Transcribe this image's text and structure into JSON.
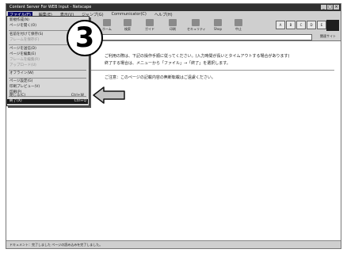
{
  "window": {
    "title": "Content Server For WEB Input - Netscape",
    "buttons": [
      "_",
      "□",
      "×"
    ]
  },
  "menubar": [
    "ファイル(F)",
    "編集(E)",
    "表示(V)",
    "ジャンプ(G)",
    "Communicator(C)",
    "ヘルプ(H)"
  ],
  "toolbar": {
    "buttons": [
      "戻る",
      "進む",
      "再読込み",
      "ホーム",
      "検索",
      "ガイド",
      "印刷",
      "セキュリティ",
      "Shop",
      "中止"
    ],
    "nav": [
      "A",
      "B",
      "C",
      "D",
      "E",
      "F"
    ]
  },
  "address": {
    "value": "http://.../ ページ",
    "go": "関連サイト"
  },
  "content": {
    "line1": "ご利用の際は、下記の操作手順に従ってください。(入力時間が長いとタイムアウトする場合があります)",
    "line2": "終了する場合は、メニューから「ファイル」→「終了」を選択します。",
    "line3": "ご注意：このページの記載内容の無断転載はご遠慮ください。"
  },
  "status": "ドキュメント：完了しました ページの読み込みを完了しました。",
  "file_menu": [
    {
      "label": "新規作成(N)",
      "shortcut": "",
      "disabled": false,
      "selected": false
    },
    {
      "label": "ページを開く(O)",
      "shortcut": "",
      "disabled": false,
      "selected": false
    },
    {
      "label": "名前を付けて保存(S)",
      "shortcut": "Ctrl+S",
      "disabled": false,
      "selected": false
    },
    {
      "label": "フレームを保存(F)",
      "shortcut": "",
      "disabled": true,
      "selected": false
    },
    {
      "label": "ページを送信(D)",
      "shortcut": "",
      "disabled": false,
      "selected": false
    },
    {
      "label": "ページを編集(E)",
      "shortcut": "",
      "disabled": false,
      "selected": false
    },
    {
      "label": "フレームを編集(R)",
      "shortcut": "",
      "disabled": true,
      "selected": false
    },
    {
      "label": "アップロード(U)",
      "shortcut": "",
      "disabled": true,
      "selected": false
    },
    {
      "label": "オフライン(W)",
      "shortcut": "",
      "disabled": false,
      "selected": false
    },
    {
      "label": "ページ設定(G)",
      "shortcut": "",
      "disabled": false,
      "selected": false
    },
    {
      "label": "印刷プレビュー(V)",
      "shortcut": "",
      "disabled": false,
      "selected": false
    },
    {
      "label": "印刷(P)",
      "shortcut": "",
      "disabled": false,
      "selected": false
    },
    {
      "label": "閉じる(C)",
      "shortcut": "Ctrl+W",
      "disabled": false,
      "selected": false
    },
    {
      "label": "終了(X)",
      "shortcut": "Ctrl+Q",
      "disabled": false,
      "selected": true
    }
  ],
  "step_number": "3",
  "colors": {
    "selection": "#1a1a1a",
    "titlebar": "#303030",
    "chrome": "#cfcfcf"
  }
}
